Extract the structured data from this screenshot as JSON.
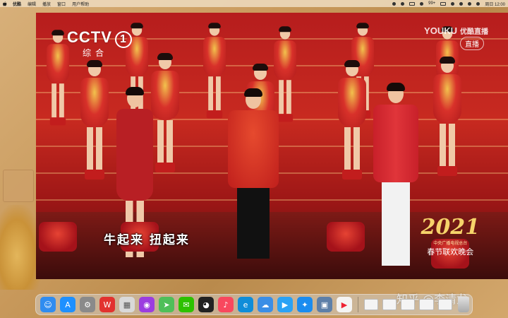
{
  "menubar": {
    "app_name": "优酷",
    "items": [
      "编辑",
      "播放",
      "窗口",
      "用户帮助"
    ],
    "battery": "99+",
    "clock": "周日 12:00"
  },
  "video": {
    "channel_logo": "CCTV",
    "channel_number": "1",
    "channel_name": "综合",
    "watermark_brand": "YOUKU",
    "watermark_sub": "优酷直播",
    "live_label": "直播",
    "subtitle": "牛起来 扭起来",
    "show_logo_year": "2021",
    "show_logo_sub": "中央广播电视总台",
    "show_logo_name": "春节联欢晚会"
  },
  "watermark": "知乎 @李清龙",
  "dock": {
    "apps": [
      {
        "name": "finder-icon",
        "glyph": "☺",
        "color": "#2f8cf0"
      },
      {
        "name": "app-store-icon",
        "glyph": "A",
        "color": "#1e90ff"
      },
      {
        "name": "system-preferences-icon",
        "glyph": "⚙",
        "color": "#8a8a8a"
      },
      {
        "name": "wps-icon",
        "glyph": "W",
        "color": "#e2322f"
      },
      {
        "name": "launchpad-icon",
        "glyph": "▦",
        "color": "#d9d9d9"
      },
      {
        "name": "podcasts-icon",
        "glyph": "◉",
        "color": "#9b3de0"
      },
      {
        "name": "maps-icon",
        "glyph": "➤",
        "color": "#4fbf59"
      },
      {
        "name": "wechat-icon",
        "glyph": "✉",
        "color": "#2dc100"
      },
      {
        "name": "qq-icon",
        "glyph": "◕",
        "color": "#222222"
      },
      {
        "name": "music-icon",
        "glyph": "♪",
        "color": "#f8485e"
      },
      {
        "name": "edge-icon",
        "glyph": "e",
        "color": "#0f8dd9"
      },
      {
        "name": "baidu-netdisk-icon",
        "glyph": "☁",
        "color": "#3a8ee6"
      },
      {
        "name": "tencent-video-icon",
        "glyph": "▶",
        "color": "#2aa2f5"
      },
      {
        "name": "safari-icon",
        "glyph": "✦",
        "color": "#1a8cf0"
      },
      {
        "name": "preview-icon",
        "glyph": "▣",
        "color": "#5d7fa8"
      },
      {
        "name": "youku-icon",
        "glyph": "▶",
        "color": "#f4f4f4"
      }
    ]
  },
  "colors": {
    "menubar_bg": "#ebd7b9",
    "stage_red": "#c82a20"
  }
}
